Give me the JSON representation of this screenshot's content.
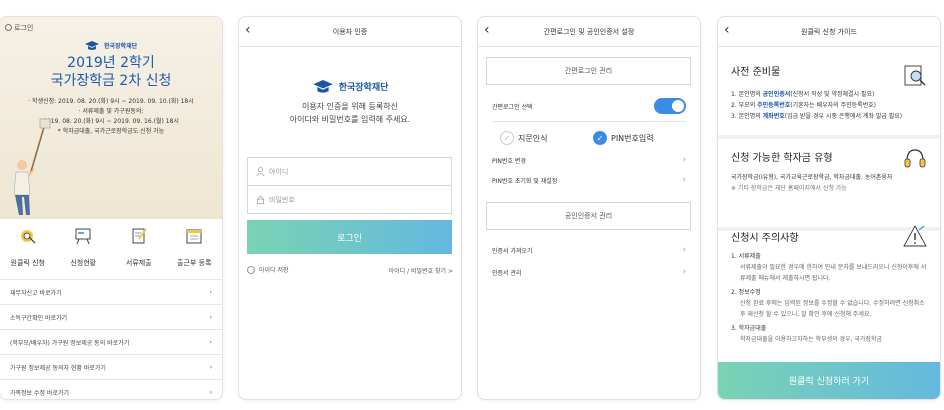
{
  "screen1": {
    "login_link": "로그인",
    "logo_small": "한국장학재단",
    "title_line1": "2019년 2학기",
    "title_line2": "국가장학금 2차 신청",
    "info": [
      "· 학생신청: 2019. 08. 20.(화) 9시 ~ 2019. 09. 10.(화) 18시",
      "· 서류제출 및 가구원동의:",
      "2019. 08. 20.(화) 9시 ~ 2019. 09. 16.(월) 18시",
      "* 학자금대출, 국가근로장학금도 신청 가능"
    ],
    "menu": [
      "원클릭 신청",
      "신청현황",
      "서류제출",
      "출근부 등록"
    ],
    "list": [
      "재무자신고 바로가기",
      "소득구간확인 바로가기",
      "(학부모/배우자) 가구원 정보제공 동의 바로가기",
      "가구원 정보제공 동의자 현황 바로가기",
      "가족정보 수정 바로가기"
    ]
  },
  "screen2": {
    "title": "이용자 인증",
    "logo_text": "한국장학재단",
    "desc_line1": "이용자 인증을 위해 등록하신",
    "desc_line2": "아이디와 비밀번호를 입력해 주세요.",
    "id_placeholder": "아이디",
    "pw_placeholder": "비밀번호",
    "login_button": "로그인",
    "keep_login": "아이디 저장",
    "find_link": "아이디 / 비밀번호 찾기 >"
  },
  "screen3": {
    "title": "간편로그인 및 공인인증서 설정",
    "section1": "간편로그인 관리",
    "simple_login_select": "간편로그인 선택",
    "option_fingerprint": "지문인식",
    "option_pin": "PIN번호입력",
    "pin_change": "PIN번호 변경",
    "pin_reset": "PIN번호 초기화 및 재설정",
    "section2": "공인인증서 관리",
    "cert_import": "인증서 가져오기",
    "cert_manage": "인증서 관리"
  },
  "screen4": {
    "title": "원클릭 신청 가이드",
    "sec1_title": "사전 준비물",
    "sec1_items": [
      {
        "num": "1.",
        "pre": "본인명의 ",
        "em": "공인인증서",
        "post": "(신청서 작성 및 약정체결시 필요)"
      },
      {
        "num": "2.",
        "pre": "부모의 ",
        "em": "주민등록번호",
        "post": "(기혼자는 배우자의 주민등록번호)"
      },
      {
        "num": "3.",
        "pre": "본인명의 ",
        "em": "계좌번호",
        "post": "(입금 받을 경우 시중 은행에서 계좌 발급 필요)"
      }
    ],
    "sec2_title": "신청 가능한 학자금 유형",
    "sec2_text": "국가장학금(Ⅰ유형), 국가교육근로장학금, 학자금대출, 농어촌융자",
    "sec2_note": "※ 기타 장학금은 재단 홈페이지에서 신청 가능",
    "sec3_title": "신청시 주의사항",
    "sec3_items": [
      {
        "head": "1.  서류제출",
        "body": "서류제출이 필요한 경우에 한하여 안내 문자를 보내드리오니 신청이후에 서류제출 메뉴에서 제출하시면 됩니다."
      },
      {
        "head": "2.  정보수정",
        "body": "신청 완료 후에는 입력된 정보를 수정할 수 없습니다. 수정하려면 신청취소 후 재신청 할 수 있으니, 잘 확인 후에 신청해 주세요."
      },
      {
        "head": "3.  학자금대출",
        "body": "학자금대출을 이용하고자하는 학부생의 경우, 국가장학금"
      }
    ],
    "apply_button": "원클릭 신청하러 가기"
  }
}
